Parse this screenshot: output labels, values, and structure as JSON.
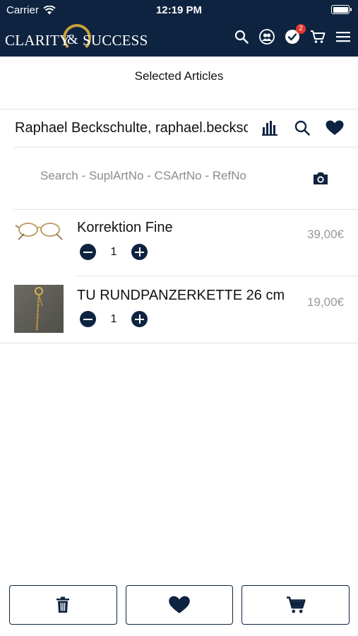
{
  "status_bar": {
    "carrier": "Carrier",
    "time": "12:19 PM"
  },
  "brand": {
    "word1": "CLARITY",
    "amp": "&",
    "word2": "SUCCESS",
    "accent_color": "#c9a13b"
  },
  "header": {
    "icons": [
      "search-icon",
      "user-group-icon",
      "check-circle-icon",
      "cart-icon",
      "menu-icon"
    ],
    "orders_badge": "2",
    "background": "#0d2340"
  },
  "page": {
    "title": "Selected Articles"
  },
  "customer": {
    "name": "Raphael Beckschulte, raphael.beckschulte",
    "icons": [
      "bar-chart-icon",
      "search-icon",
      "heart-icon"
    ]
  },
  "search": {
    "placeholder": "Search - SuplArtNo - CSArtNo - RefNo",
    "value": ""
  },
  "articles": [
    {
      "name": "Korrektion Fine",
      "qty": "1",
      "price": "39,00€",
      "thumb": "glasses"
    },
    {
      "name": "TU RUNDPANZERKETTE 26 cm",
      "qty": "1",
      "price": "19,00€",
      "thumb": "chain"
    }
  ],
  "bottom_actions": [
    "trash-icon",
    "heart-icon",
    "cart-icon"
  ]
}
